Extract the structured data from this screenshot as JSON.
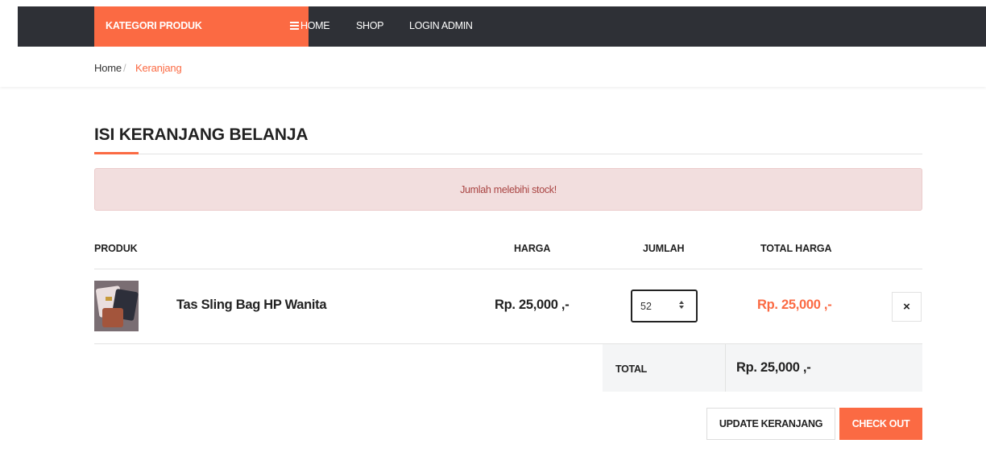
{
  "nav": {
    "category_button": "KATEGORI PRODUK",
    "links": [
      "HOME",
      "SHOP",
      "LOGIN ADMIN"
    ]
  },
  "breadcrumb": {
    "home": "Home",
    "separator": "/",
    "current": "Keranjang"
  },
  "page": {
    "title": "ISI KERANJANG BELANJA"
  },
  "alert": {
    "message": "Jumlah melebihi stock!"
  },
  "cart_table": {
    "headers": {
      "product": "PRODUK",
      "price": "HARGA",
      "quantity": "JUMLAH",
      "total": "TOTAL HARGA"
    },
    "items": [
      {
        "name": "Tas Sling Bag HP Wanita",
        "price": "Rp. 25,000 ,-",
        "quantity": "52",
        "total": "Rp. 25,000 ,-",
        "remove_symbol": "×"
      }
    ]
  },
  "summary": {
    "label": "TOTAL",
    "value": "Rp. 25,000 ,-"
  },
  "actions": {
    "update": "UPDATE KERANJANG",
    "checkout": "CHECK OUT"
  },
  "colors": {
    "accent": "#fb6a43",
    "navbar": "#2e3036",
    "alert_bg": "#f2dede",
    "alert_text": "#a94442"
  },
  "icons": {
    "menu": "menu-icon",
    "remove": "close-icon"
  }
}
